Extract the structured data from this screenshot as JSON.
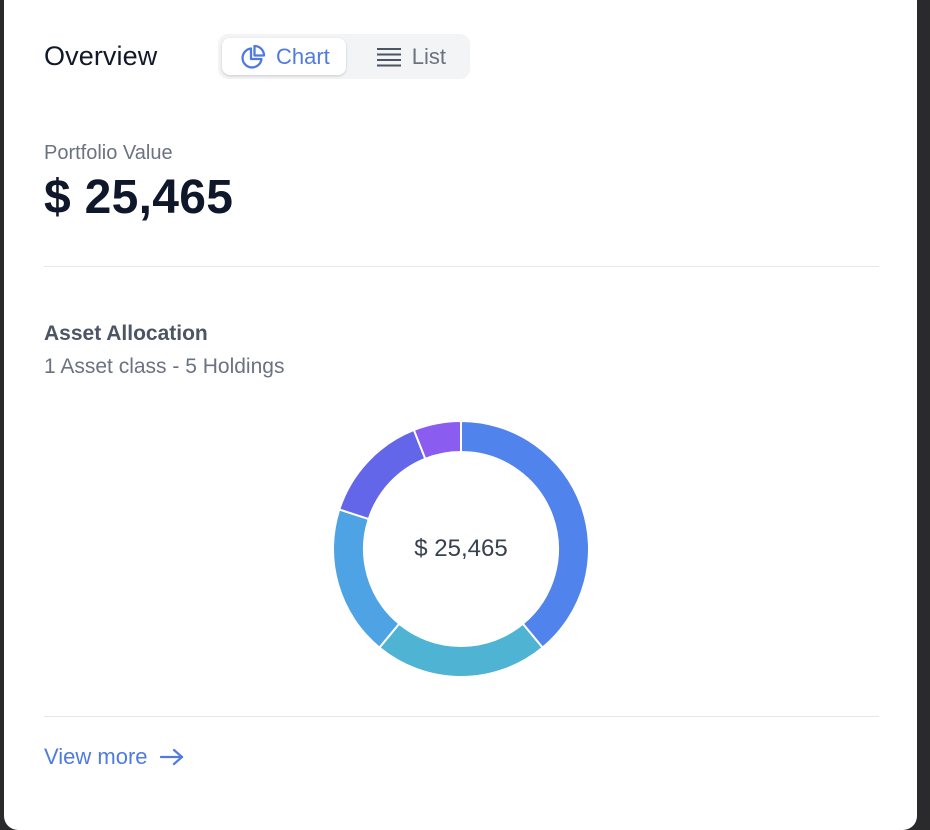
{
  "header": {
    "title": "Overview",
    "view_toggle": {
      "chart_label": "Chart",
      "list_label": "List",
      "selected": "Chart"
    }
  },
  "portfolio": {
    "label": "Portfolio Value",
    "value": "$ 25,465"
  },
  "allocation": {
    "title": "Asset Allocation",
    "subtitle": "1 Asset class - 5 Holdings",
    "center_label": "$ 25,465"
  },
  "footer": {
    "view_more_label": "View more"
  },
  "colors": {
    "accent": "#4f7be0",
    "segments": [
      "#5183ec",
      "#4fb3d3",
      "#4ea3e4",
      "#6366e8",
      "#8b5cf0"
    ]
  },
  "chart_data": {
    "type": "pie",
    "values": [
      39,
      22,
      19,
      14,
      6
    ]
  }
}
